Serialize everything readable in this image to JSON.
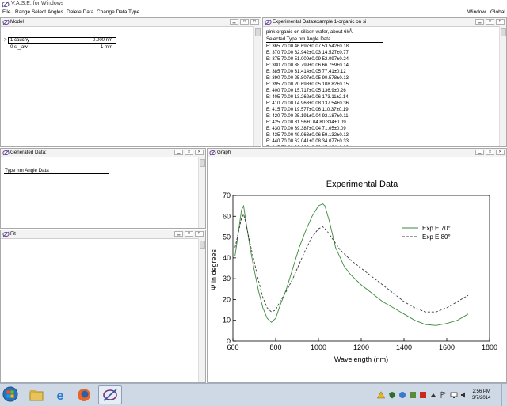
{
  "app": {
    "title": "V.A.S.E. for Windows"
  },
  "menu": {
    "left": [
      "File",
      "Range Select",
      "Angles",
      "Delete Data",
      "Change Data Type"
    ],
    "right": [
      "Window",
      "Global"
    ]
  },
  "model": {
    "title": "Model",
    "marker": ">",
    "rows": [
      {
        "label": "1 cauchy",
        "value": "0.000 nm"
      },
      {
        "label": "0 si_jaw",
        "value": "1 mm"
      }
    ]
  },
  "expdata": {
    "title": "Experimental Data:example 1-organic on si",
    "description": "pink organic on silicon wafer, about 6kÅ",
    "header": "Selected Type  nm  Angle  Data",
    "rows": [
      "E: 365  70.00  46.697±0.07  53.542±0.18",
      "E: 370  70.00  62.942±0.03  14.527±0.77",
      "E: 375  70.00  51.009±0.09  52.097±0.24",
      "E: 380  70.00  38.799±0.06  66.759±0.14",
      "E: 385  70.00  31.414±0.05  77.41±0.12",
      "E: 390  70.00  25.807±0.05  90.578±0.13",
      "E: 395  70.00  20.698±0.05  108.82±0.15",
      "E: 400  70.00  15.717±0.05  136.9±0.26",
      "E: 405  70.00  13.262±0.06  173.11±2.14",
      "E: 410  70.00  14.963±0.08  137.54±0.36",
      "E: 415  70.00  19.577±0.06  110.37±0.19",
      "E: 420  70.00  25.191±0.04  92.187±0.11",
      "E: 425  70.00  31.56±0.04  80.334±0.09",
      "E: 430  70.00  39.387±0.04  71.05±0.09",
      "E: 435  70.00  49.963±0.06  59.132±0.13",
      "E: 440  70.00  62.041±0.08  34.077±0.33",
      "E: 445  70.00  60.009±0.09  47.694±0.09"
    ]
  },
  "generated": {
    "title": "Generated Data:",
    "header": "Type  nm  Angle  Data"
  },
  "fit": {
    "title": "Fit"
  },
  "graph": {
    "title": "Graph"
  },
  "chart_data": {
    "type": "line",
    "title": "Experimental Data",
    "xlabel": "Wavelength (nm)",
    "ylabel": "Ψ in degrees",
    "xlim": [
      600,
      1800
    ],
    "ylim": [
      0,
      70
    ],
    "xticks": [
      600,
      800,
      1000,
      1200,
      1400,
      1600,
      1800
    ],
    "yticks": [
      0,
      10,
      20,
      30,
      40,
      50,
      60,
      70
    ],
    "legend_position": "right",
    "series": [
      {
        "name": "Exp E 70°",
        "style": "solid",
        "color": "#3c8a3c",
        "x": [
          610,
          625,
          640,
          650,
          660,
          680,
          700,
          720,
          740,
          760,
          780,
          800,
          820,
          850,
          880,
          910,
          940,
          970,
          1000,
          1020,
          1030,
          1050,
          1080,
          1120,
          1150,
          1200,
          1250,
          1300,
          1350,
          1400,
          1450,
          1500,
          1550,
          1600,
          1650,
          1700
        ],
        "y": [
          41,
          52,
          63,
          65,
          58,
          45,
          34,
          24,
          16,
          11,
          9,
          11,
          17,
          25,
          35,
          45,
          53,
          60,
          65,
          66,
          65,
          58,
          45,
          36,
          32,
          27,
          23,
          19,
          16,
          13,
          10,
          8,
          7.5,
          8.5,
          10,
          13
        ]
      },
      {
        "name": "Exp E 80°",
        "style": "dashed",
        "color": "#3a3a3a",
        "x": [
          610,
          625,
          640,
          650,
          660,
          680,
          700,
          720,
          740,
          760,
          780,
          800,
          820,
          850,
          880,
          910,
          940,
          970,
          1000,
          1020,
          1040,
          1060,
          1100,
          1150,
          1200,
          1250,
          1300,
          1350,
          1400,
          1450,
          1500,
          1550,
          1600,
          1650,
          1700
        ],
        "y": [
          45,
          52,
          59,
          61,
          57,
          47,
          38,
          29,
          21,
          16,
          14,
          15,
          19,
          24,
          30,
          37,
          44,
          50,
          54,
          55,
          53,
          50,
          44,
          39,
          35,
          31,
          27,
          23,
          19,
          16,
          14,
          14,
          16,
          19,
          22
        ]
      }
    ]
  },
  "taskbar": {
    "time": "2:56 PM",
    "date": "3/7/2014"
  }
}
